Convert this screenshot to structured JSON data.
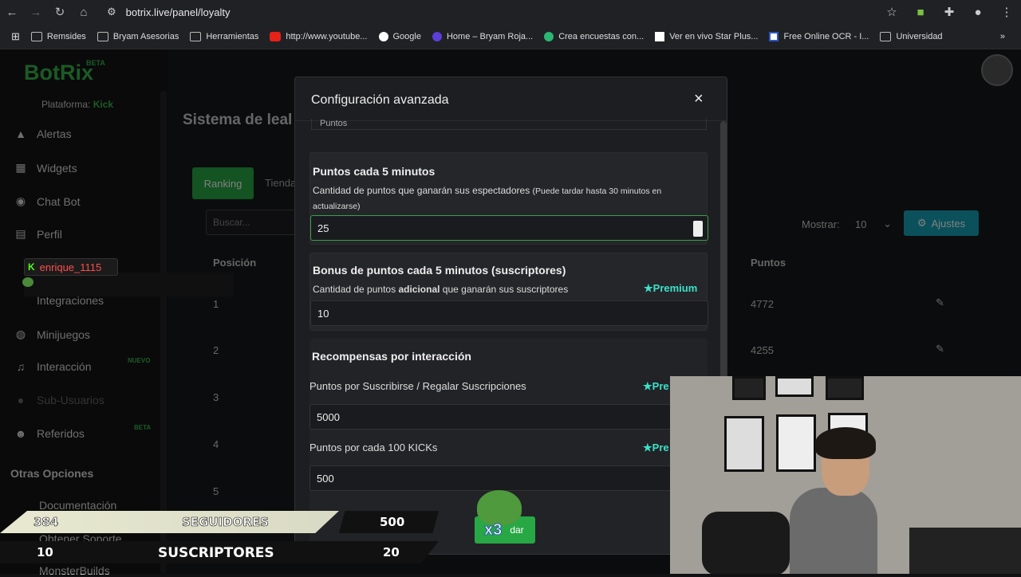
{
  "browser": {
    "url": "botrix.live/panel/loyalty",
    "bookmarks": [
      {
        "label": "Remsides",
        "icon": "folder-icon"
      },
      {
        "label": "Bryam Asesorias",
        "icon": "folder-icon"
      },
      {
        "label": "Herramientas",
        "icon": "folder-icon"
      },
      {
        "label": "http://www.youtube...",
        "icon": "youtube-icon"
      },
      {
        "label": "Google",
        "icon": "google-icon"
      },
      {
        "label": "Home – Bryam Roja...",
        "icon": "site-icon"
      },
      {
        "label": "Crea encuestas con...",
        "icon": "survey-icon"
      },
      {
        "label": "Ver en vivo Star Plus...",
        "icon": "page-icon"
      },
      {
        "label": "Free Online OCR - I...",
        "icon": "ocr-icon"
      },
      {
        "label": "Universidad",
        "icon": "folder-icon"
      }
    ]
  },
  "sidebar": {
    "brand": "BotRix",
    "beta": "BETA",
    "platform_label": "Plataforma:",
    "platform_value": "Kick",
    "items": [
      {
        "label": "Alertas"
      },
      {
        "label": "Widgets"
      },
      {
        "label": "Chat Bot"
      },
      {
        "label": "Perfil"
      },
      {
        "label": "Integraciones"
      },
      {
        "label": "Minijuegos"
      },
      {
        "label": "Interacción",
        "badge": "NUEVO"
      },
      {
        "label": "Sub-Usuarios"
      },
      {
        "label": "Referidos",
        "badge": "BETA"
      }
    ],
    "other_options": "Otras Opciones",
    "extra_items": [
      {
        "label": "Documentación"
      },
      {
        "label": "Obtener Soporte"
      },
      {
        "label": "MonsterBuilds"
      }
    ]
  },
  "chat": {
    "username": "enrique_1115"
  },
  "main": {
    "title": "Sistema de leal",
    "tabs": [
      {
        "label": "Ranking"
      },
      {
        "label": "Tienda"
      }
    ],
    "search_placeholder": "Buscar...",
    "show_label": "Mostrar:",
    "show_value": "10",
    "settings_label": "Ajustes",
    "col_position": "Posición",
    "col_points": "Puntos",
    "rows": [
      {
        "rank": "1",
        "points": "4772"
      },
      {
        "rank": "2",
        "points": "4255"
      },
      {
        "rank": "3",
        "points": ""
      },
      {
        "rank": "4",
        "points": ""
      },
      {
        "rank": "5",
        "points": ""
      }
    ]
  },
  "modal": {
    "title": "Configuración avanzada",
    "close": "×",
    "prev_select": "Puntos",
    "points_title": "Puntos cada 5 minutos",
    "points_desc": "Cantidad de puntos que ganarán sus espectadores",
    "points_note": "(Puede tardar hasta 30 minutos en actualizarse)",
    "points_value": "25",
    "bonus_title": "Bonus de puntos cada 5 minutos (suscriptores)",
    "bonus_desc_a": "Cantidad de puntos",
    "bonus_desc_b": "adicional",
    "bonus_desc_c": "que ganarán sus suscriptores",
    "bonus_value": "10",
    "premium": "Premium",
    "rewards_title": "Recompensas por interacción",
    "rewards": [
      {
        "label": "Puntos por Suscribirse / Regalar Suscripciones",
        "value": "5000",
        "premium": "Pre"
      },
      {
        "label": "Puntos por cada 100 KICKs",
        "value": "500",
        "premium": "Pre"
      }
    ]
  },
  "stream_overlay": {
    "followers_count": "384",
    "followers_label": "SEGUIDORES",
    "followers_goal": "500",
    "subs_count": "10",
    "subs_label": "SUSCRIPTORES",
    "subs_goal": "20",
    "pepe_badge": "x3",
    "save_label": "dar"
  },
  "colors": {
    "brand_green": "#39b54a",
    "kick_green": "#53fc18",
    "premium_teal": "#3be2c9",
    "settings_blue": "#17a2b8"
  }
}
